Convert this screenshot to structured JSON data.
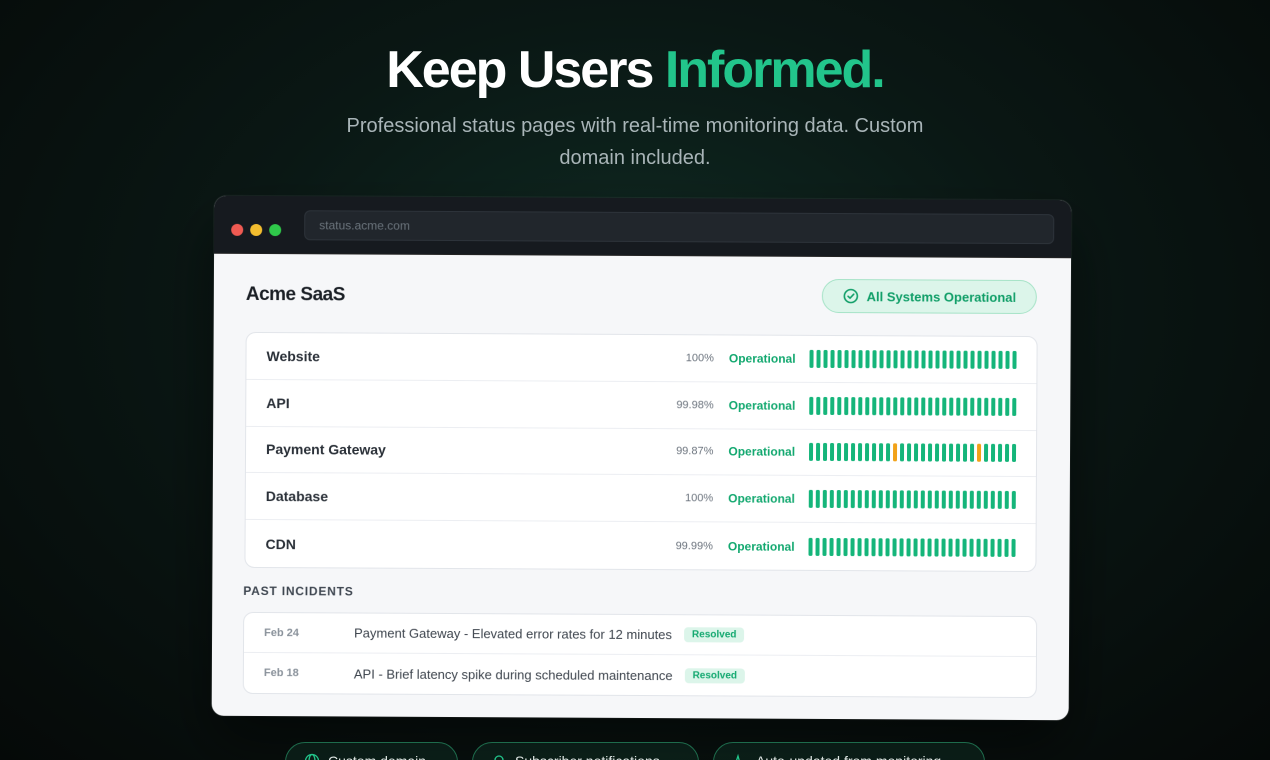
{
  "hero": {
    "title_main": "Keep Users ",
    "title_accent": "Informed.",
    "subtitle": "Professional status pages with real-time monitoring data. Custom domain included."
  },
  "window": {
    "url": "status.acme.com",
    "brand": "Acme SaaS",
    "overall_status": "All Systems Operational"
  },
  "services": [
    {
      "name": "Website",
      "uptime": "100%",
      "status": "Operational",
      "warn_bars": []
    },
    {
      "name": "API",
      "uptime": "99.98%",
      "status": "Operational",
      "warn_bars": []
    },
    {
      "name": "Payment Gateway",
      "uptime": "99.87%",
      "status": "Operational",
      "warn_bars": [
        12,
        24
      ]
    },
    {
      "name": "Database",
      "uptime": "100%",
      "status": "Operational",
      "warn_bars": []
    },
    {
      "name": "CDN",
      "uptime": "99.99%",
      "status": "Operational",
      "warn_bars": []
    }
  ],
  "bar_count": 30,
  "incidents_title": "PAST INCIDENTS",
  "incidents": [
    {
      "date": "Feb 24",
      "text": "Payment Gateway - Elevated error rates for 12 minutes",
      "badge": "Resolved"
    },
    {
      "date": "Feb 18",
      "text": "API - Brief latency spike during scheduled maintenance",
      "badge": "Resolved"
    }
  ],
  "feature_pills": [
    {
      "label": "Custom domain",
      "icon": "globe-icon"
    },
    {
      "label": "Subscriber notifications",
      "icon": "bell-icon"
    },
    {
      "label": "Auto-updated from monitoring",
      "icon": "pulse-icon"
    }
  ],
  "colors": {
    "accent": "#22c58b",
    "operational": "#15b57a",
    "warning": "#f2a218"
  }
}
